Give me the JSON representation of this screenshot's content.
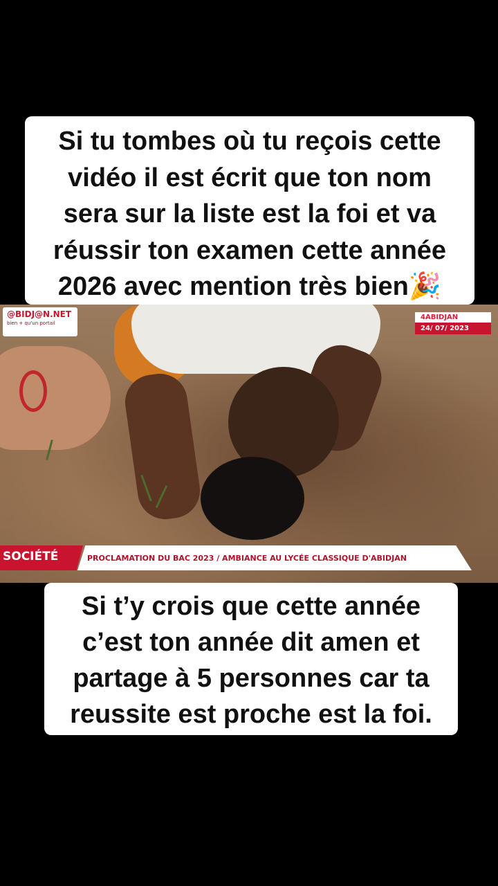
{
  "captions": {
    "top": [
      "Si tu tombes où tu reçois cette",
      "vidéo il est écrit que ton nom",
      "sera sur la liste est la foi et va",
      "réussir ton examen cette année",
      "2026 avec mention très bien🎉"
    ],
    "bottom": [
      "Si t’y crois que cette année",
      "c’est ton année dit amen et",
      "partage à 5 personnes car ta",
      "reussite est proche est la foi."
    ]
  },
  "video": {
    "logo": {
      "text": "@BIDJ@N.NET",
      "tagline": "bien + qu'un portail"
    },
    "location_badge": {
      "city": "4ABIDJAN",
      "date": "24/ 07/ 2023"
    },
    "ticker": {
      "label": "SOCIÉTÉ",
      "headline": "PROCLAMATION DU BAC 2023 / AMBIANCE AU LYCÉE CLASSIQUE D'ABIDJAN"
    }
  }
}
